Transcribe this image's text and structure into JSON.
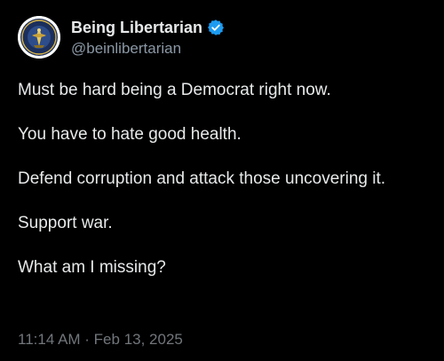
{
  "author": {
    "display_name": "Being Libertarian",
    "handle": "@beinlibertarian",
    "verified": true,
    "verified_badge_color": "#1d9bf0",
    "avatar_icon": "libertarian-seal-icon"
  },
  "tweet": {
    "paragraphs": [
      "Must be hard being a Democrat right now.",
      "You have to hate good health.",
      "Defend corruption and attack those uncovering it.",
      "Support war.",
      "What am I missing?"
    ],
    "timestamp": "11:14 AM · Feb 13, 2025"
  },
  "colors": {
    "background": "#000000",
    "text_primary": "#e7e9ea",
    "text_secondary": "#71767b"
  }
}
